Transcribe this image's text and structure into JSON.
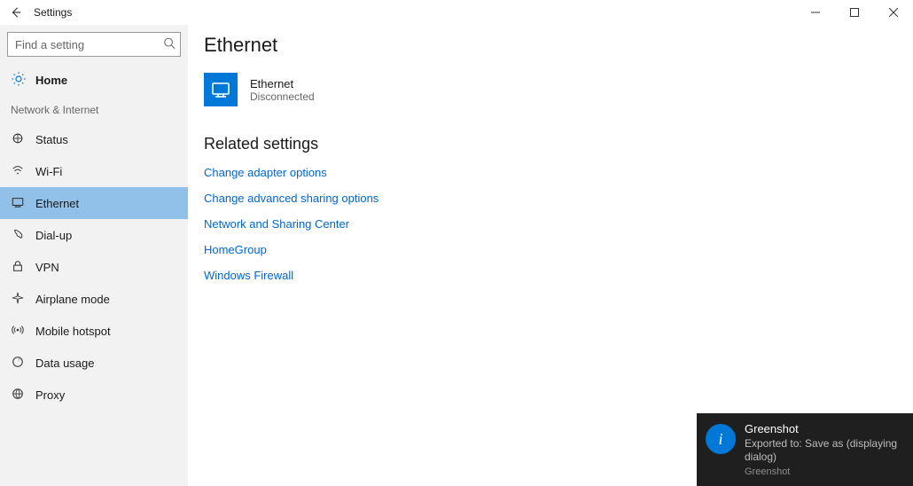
{
  "titlebar": {
    "title": "Settings"
  },
  "search": {
    "placeholder": "Find a setting"
  },
  "home_label": "Home",
  "category_label": "Network & Internet",
  "nav": [
    {
      "label": "Status"
    },
    {
      "label": "Wi-Fi"
    },
    {
      "label": "Ethernet"
    },
    {
      "label": "Dial-up"
    },
    {
      "label": "VPN"
    },
    {
      "label": "Airplane mode"
    },
    {
      "label": "Mobile hotspot"
    },
    {
      "label": "Data usage"
    },
    {
      "label": "Proxy"
    }
  ],
  "main": {
    "heading": "Ethernet",
    "adapter": {
      "name": "Ethernet",
      "state": "Disconnected"
    },
    "related_heading": "Related settings",
    "links": [
      "Change adapter options",
      "Change advanced sharing options",
      "Network and Sharing Center",
      "HomeGroup",
      "Windows Firewall"
    ]
  },
  "toast": {
    "title": "Greenshot",
    "body": "Exported to: Save as (displaying dialog)",
    "app": "Greenshot"
  }
}
